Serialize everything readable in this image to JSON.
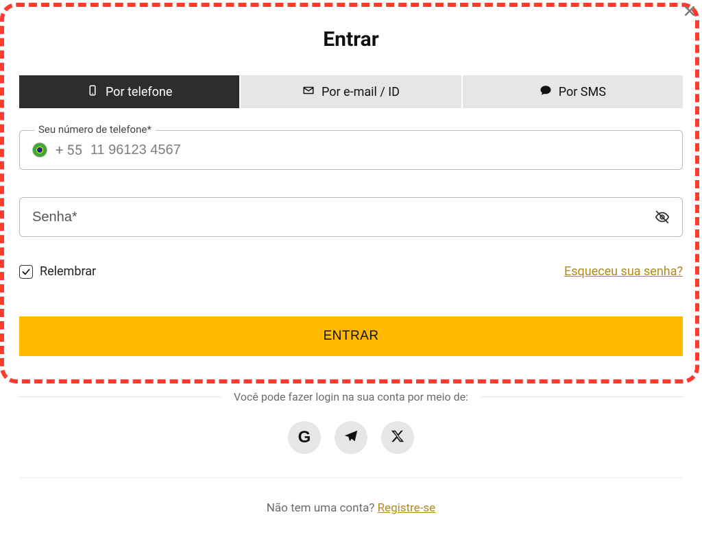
{
  "title": "Entrar",
  "tabs": {
    "phone": "Por telefone",
    "email": "Por e-mail / ID",
    "sms": "Por SMS"
  },
  "phone_field": {
    "label": "Seu número de telefone*",
    "dialcode": "+ 55",
    "placeholder": "11 96123 4567"
  },
  "password_field": {
    "placeholder": "Senha*"
  },
  "remember_label": "Relembrar",
  "forgot_label": "Esqueceu sua senha?",
  "submit_label": "ENTRAR",
  "social_login_text": "Você pode fazer login na sua conta por meio de:",
  "no_account_text": "Não tem uma conta? ",
  "register_label": "Registre-se"
}
